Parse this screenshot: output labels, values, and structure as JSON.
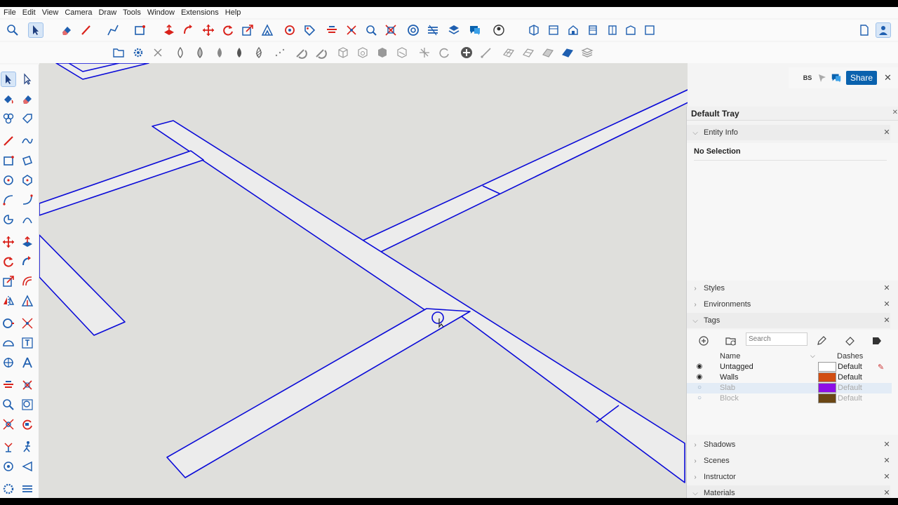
{
  "menu": [
    "File",
    "Edit",
    "View",
    "Camera",
    "Draw",
    "Tools",
    "Window",
    "Extensions",
    "Help"
  ],
  "colors": {
    "accent": "#0a62ae",
    "edge": "#0a0ad8",
    "face": "#ececec",
    "background": "#dfdfdc",
    "tool_red": "#d9221b",
    "tool_blue": "#1f5fb0"
  },
  "toolbar1_icons": [
    "search-icon",
    "select-arrow-icon",
    "eraser-icon",
    "pencil-icon",
    "line-icon",
    "rectangle-icon",
    "push-pull-icon",
    "follow-me-icon",
    "move-icon",
    "rotate-icon",
    "scale-icon",
    "protractor-icon",
    "section-plane-icon",
    "tag-icon",
    "offset-icon",
    "tape-measure-icon",
    "zoom-extents-icon",
    "outliner-icon",
    "layers-icon",
    "sandbox-icon",
    "chat-icon",
    "3d-warehouse-icon",
    "iso-view-icon",
    "top-view-icon",
    "front-view-icon",
    "right-view-icon",
    "back-view-icon",
    "left-view-icon",
    "bottom-view-icon",
    "new-file-icon",
    "profile-icon"
  ],
  "toolbar2_icons": [
    "folder-icon",
    "gear-icon",
    "close-x-icon",
    "drop-outline-icon",
    "drop-half-icon",
    "drop-solid-icon",
    "drop-striped-icon",
    "dots-icon",
    "magnet-icon",
    "magnet-alt-icon",
    "cube-wire-icon",
    "cube-hidden-icon",
    "cube-shaded-icon",
    "cube-texture-icon",
    "axes-icon",
    "orbit-icon",
    "add-icon",
    "line-tool-icon",
    "surface-1-icon",
    "surface-2-icon",
    "surface-3-icon",
    "surface-4-icon",
    "stack-icon"
  ],
  "share": {
    "avatar": "BS",
    "button": "Share"
  },
  "tray": {
    "title": "Default Tray",
    "entity_info": {
      "title": "Entity Info",
      "status": "No Selection"
    },
    "panels_collapsed_top": [
      "Styles",
      "Environments"
    ],
    "tags": {
      "title": "Tags",
      "search_placeholder": "Search",
      "col_name": "Name",
      "col_dashes": "Dashes",
      "rows": [
        {
          "name": "Untagged",
          "color": "#ffffff",
          "dashes": "Default",
          "visible": true
        },
        {
          "name": "Walls",
          "color": "#d24e12",
          "dashes": "Default",
          "visible": true
        },
        {
          "name": "Slab",
          "color": "#8d0ee6",
          "dashes": "Default",
          "visible": false
        },
        {
          "name": "Block",
          "color": "#6b4714",
          "dashes": "Default",
          "visible": false
        }
      ]
    },
    "panels_collapsed_bottom": [
      "Shadows",
      "Scenes",
      "Instructor",
      "Materials"
    ]
  }
}
